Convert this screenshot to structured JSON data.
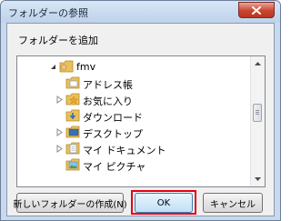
{
  "window": {
    "title": "フォルダーの参照"
  },
  "dialog": {
    "instruction": "フォルダーを追加",
    "tree": {
      "items": [
        {
          "label": "fmv",
          "expander": "expanded-arrow",
          "icon": "user-folder-icon"
        },
        {
          "label": "アドレス帳",
          "expander": "",
          "icon": "address-book-folder-icon"
        },
        {
          "label": "お気に入り",
          "expander": "collapsed-arrow",
          "icon": "favorites-folder-icon"
        },
        {
          "label": "ダウンロード",
          "expander": "",
          "icon": "downloads-folder-icon"
        },
        {
          "label": "デスクトップ",
          "expander": "collapsed-arrow",
          "icon": "desktop-folder-icon"
        },
        {
          "label": "マイ ドキュメント",
          "expander": "collapsed-arrow",
          "icon": "documents-folder-icon"
        },
        {
          "label": "マイ ピクチャ",
          "expander": "",
          "icon": "pictures-folder-icon"
        }
      ]
    }
  },
  "buttons": {
    "new_folder": "新しいフォルダーの作成(N)",
    "ok": "OK",
    "cancel": "キャンセル"
  },
  "colors": {
    "highlight": "#e60012",
    "folder": "#e9c15a",
    "selection_accent": "#3c7fb1"
  }
}
